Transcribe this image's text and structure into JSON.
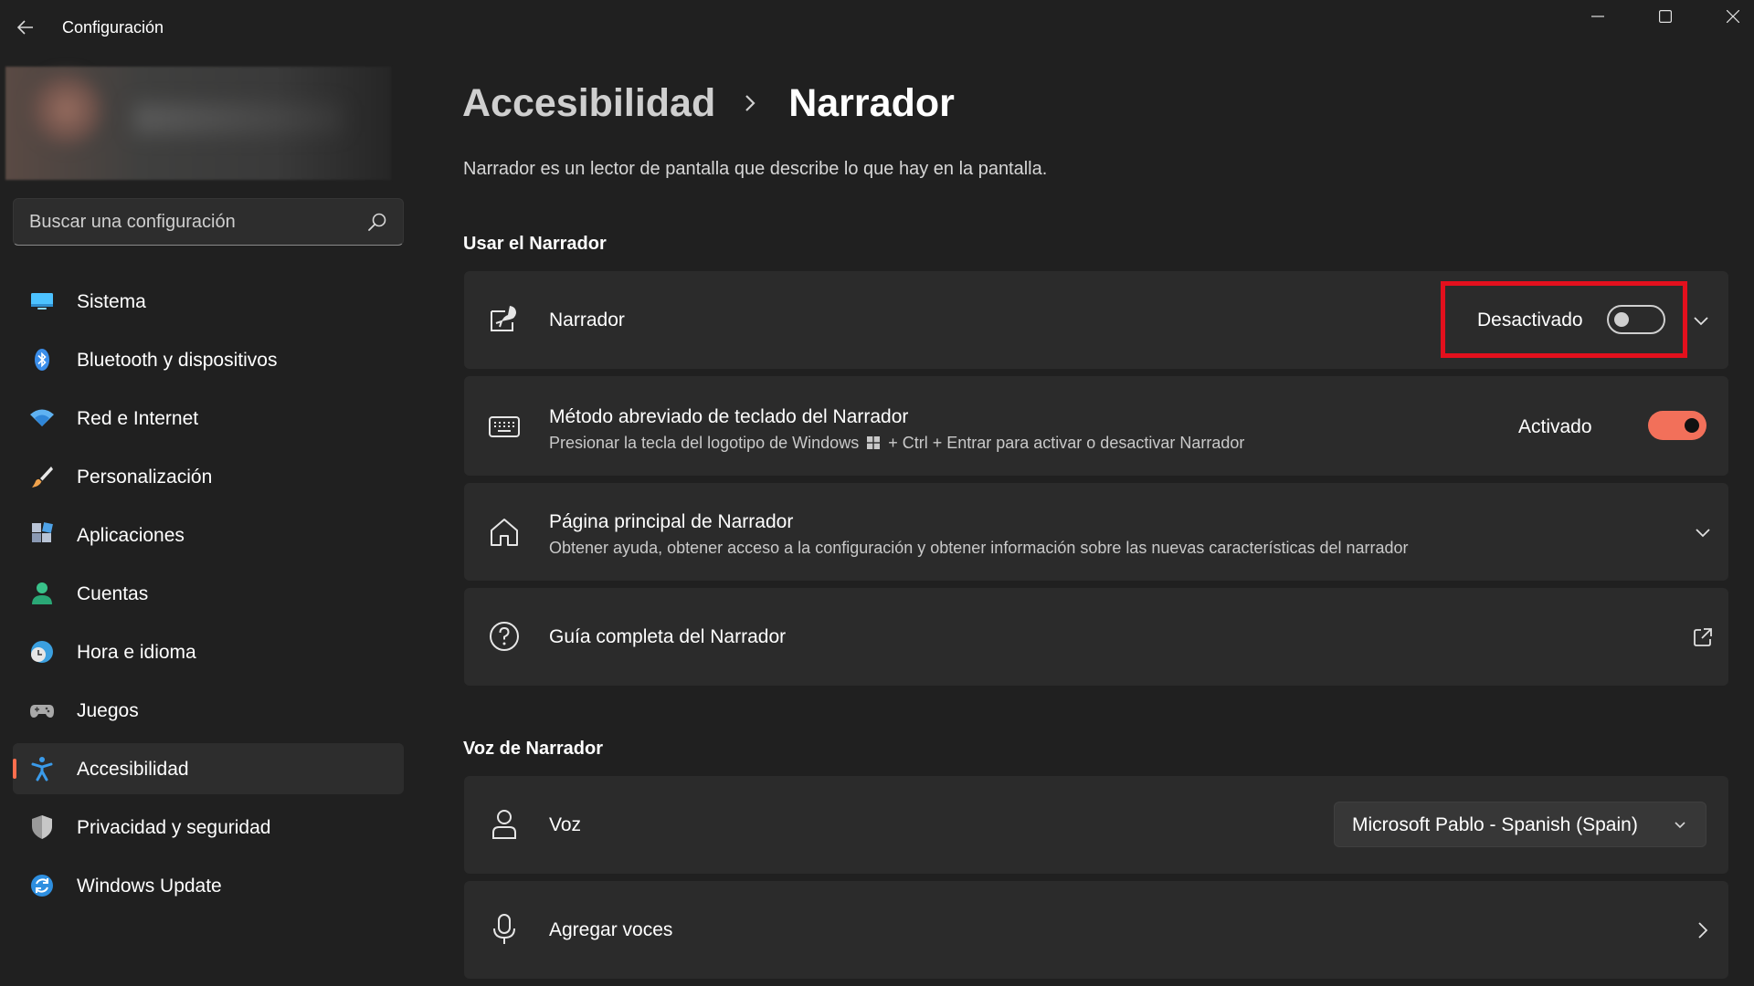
{
  "window": {
    "title": "Configuración",
    "back_icon": "back-arrow-icon",
    "controls": [
      "minimize-icon",
      "maximize-icon",
      "close-icon"
    ]
  },
  "sidebar": {
    "search": {
      "placeholder": "Buscar una configuración",
      "icon": "search-icon"
    },
    "items": [
      {
        "label": "Sistema",
        "icon": "monitor-icon",
        "color": "#4cc2ff"
      },
      {
        "label": "Bluetooth y dispositivos",
        "icon": "bluetooth-icon",
        "color": "#3b8eea"
      },
      {
        "label": "Red e Internet",
        "icon": "wifi-icon",
        "color": "#5fb2f2"
      },
      {
        "label": "Personalización",
        "icon": "brush-icon",
        "color": "#f0a24c"
      },
      {
        "label": "Aplicaciones",
        "icon": "apps-icon",
        "color": "#9aa8bf"
      },
      {
        "label": "Cuentas",
        "icon": "person-icon",
        "color": "#39c28a"
      },
      {
        "label": "Hora e idioma",
        "icon": "globe-clock-icon",
        "color": "#3ba0e0"
      },
      {
        "label": "Juegos",
        "icon": "gamepad-icon",
        "color": "#a9a9a9"
      },
      {
        "label": "Accesibilidad",
        "icon": "accessibility-icon",
        "color": "#3a9bea",
        "active": true
      },
      {
        "label": "Privacidad y seguridad",
        "icon": "shield-icon",
        "color": "#9a9a9a"
      },
      {
        "label": "Windows Update",
        "icon": "update-icon",
        "color": "#2e8fe0"
      }
    ]
  },
  "main": {
    "breadcrumb": {
      "parent": "Accesibilidad",
      "current": "Narrador"
    },
    "description": "Narrador es un lector de pantalla que describe lo que hay en la pantalla.",
    "sections": [
      {
        "title": "Usar el Narrador",
        "cards": [
          {
            "title": "Narrador",
            "icon": "narrator-icon",
            "state": "Desactivado",
            "toggle_on": false,
            "expandable": true
          },
          {
            "title": "Método abreviado de teclado del Narrador",
            "subtitle_before": "Presionar la tecla del logotipo de Windows",
            "subtitle_after": "+ Ctrl + Entrar para activar o desactivar Narrador",
            "icon": "keyboard-icon",
            "state": "Activado",
            "toggle_on": true
          },
          {
            "title": "Página principal de Narrador",
            "subtitle": "Obtener ayuda, obtener acceso a la configuración y obtener información sobre las nuevas características del narrador",
            "icon": "home-icon",
            "expandable": true
          },
          {
            "title": "Guía completa del Narrador",
            "icon": "help-icon",
            "link": "open-external-icon"
          }
        ]
      },
      {
        "title": "Voz de Narrador",
        "cards": [
          {
            "title": "Voz",
            "icon": "person-outline-icon",
            "dropdown": "Microsoft Pablo - Spanish (Spain)"
          },
          {
            "title": "Agregar voces",
            "icon": "microphone-icon",
            "navigate": "chevron-right-icon"
          }
        ]
      }
    ]
  },
  "colors": {
    "background": "#202020",
    "card": "#2b2b2b",
    "accent": "#f2705a",
    "highlight_box": "#e3101d"
  }
}
